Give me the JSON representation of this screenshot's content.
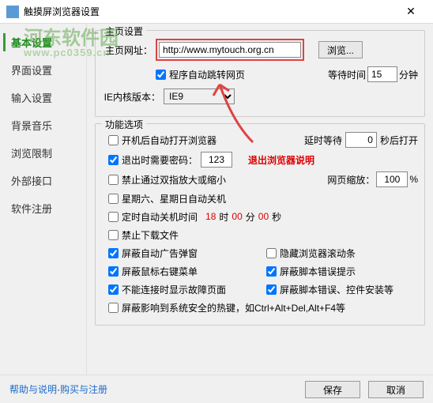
{
  "title": "触摸屏浏览器设置",
  "watermark": {
    "main": "河东软件园",
    "sub": "www.pc0359.cn"
  },
  "sidebar": {
    "items": [
      {
        "label": "基本设置"
      },
      {
        "label": "界面设置"
      },
      {
        "label": "输入设置"
      },
      {
        "label": "背景音乐"
      },
      {
        "label": "浏览限制"
      },
      {
        "label": "外部接口"
      },
      {
        "label": "软件注册"
      }
    ]
  },
  "homepage": {
    "group_title": "主页设置",
    "url_label": "主页网址：",
    "url_value": "http://www.mytouch.org.cn",
    "browse_btn": "浏览...",
    "auto_jump_label": "程序自动跳转网页",
    "wait_label": "等待时间",
    "wait_value": "15",
    "wait_unit": "分钟",
    "ie_label": "IE内核版本：",
    "ie_value": "IE9"
  },
  "options": {
    "group_title": "功能选项",
    "autostart": "开机后自动打开浏览器",
    "delay_label": "延时等待",
    "delay_value": "0",
    "delay_unit": "秒后打开",
    "exit_pwd": "退出时需要密码：",
    "exit_pwd_value": "123",
    "exit_note": "退出浏览器说明",
    "no_pinch": "禁止通过双指放大或缩小",
    "zoom_label": "网页缩放：",
    "zoom_value": "100",
    "zoom_unit": "%",
    "weekend_off": "星期六、星期日自动关机",
    "timer_off": "定时自动关机时间",
    "timer_h": "18",
    "timer_h_unit": "时",
    "timer_m": "00",
    "timer_m_unit": "分",
    "timer_s": "00",
    "timer_s_unit": "秒",
    "no_download": "禁止下载文件",
    "block_ads": "屏蔽自动广告弹窗",
    "hide_scroll": "隐藏浏览器滚动条",
    "block_rclick": "屏蔽鼠标右键菜单",
    "block_script_err": "屏蔽脚本错误提示",
    "no_conn_page": "不能连接时显示故障页面",
    "block_script_ax": "屏蔽脚本错误、控件安装等",
    "block_hotkeys": "屏蔽影响到系统安全的热键，如Ctrl+Alt+Del,Alt+F4等"
  },
  "footer": {
    "help": "帮助与说明",
    "sep": " · ",
    "buy": "购买与注册",
    "save": "保存",
    "cancel": "取消"
  }
}
